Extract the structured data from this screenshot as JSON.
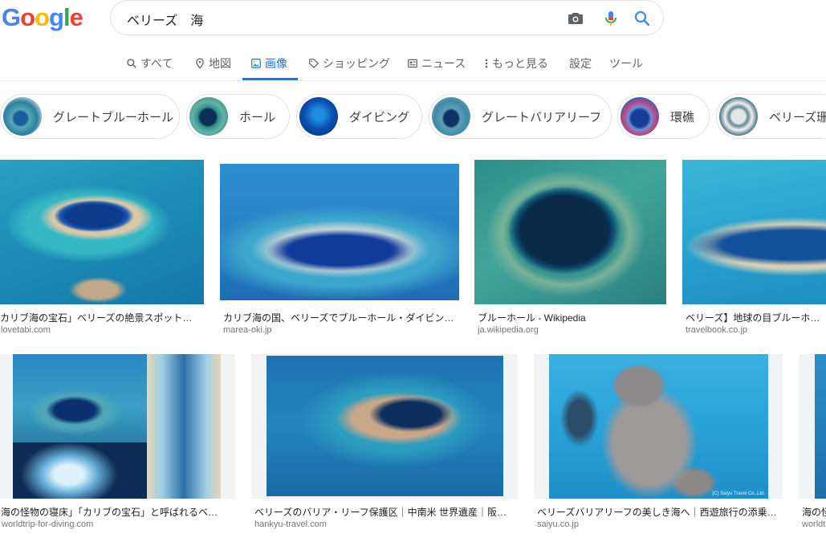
{
  "logo": {
    "letters": [
      "G",
      "o",
      "o",
      "g",
      "l",
      "e"
    ],
    "colors": [
      "#4285f4",
      "#ea4335",
      "#fbbc05",
      "#4285f4",
      "#34a853",
      "#ea4335"
    ]
  },
  "search": {
    "query": "ベリーズ　海",
    "icons": [
      "camera-icon",
      "mic-icon",
      "search-icon"
    ]
  },
  "tabs": [
    {
      "label": "すべて",
      "icon": "search-icon"
    },
    {
      "label": "地図",
      "icon": "map-pin-icon"
    },
    {
      "label": "画像",
      "icon": "image-icon"
    },
    {
      "label": "ショッピング",
      "icon": "tag-icon"
    },
    {
      "label": "ニュース",
      "icon": "news-icon"
    },
    {
      "label": "もっと見る",
      "icon": "more-vert-icon"
    },
    {
      "label": "設定"
    },
    {
      "label": "ツール"
    }
  ],
  "active_tab": "画像",
  "colors": {
    "accent": "#1a73e8",
    "tab_text": "#5f6368",
    "source_text": "#70757a"
  },
  "chips": [
    {
      "label": "グレートブルーホール"
    },
    {
      "label": "ホール"
    },
    {
      "label": "ダイビング"
    },
    {
      "label": "グレートバリアリーフ"
    },
    {
      "label": "環礁"
    },
    {
      "label": "ベリーズ珊瑚"
    }
  ],
  "results": [
    {
      "title": "カリブ海の宝石」ベリーズの絶景スポット…",
      "source": "lovetabi.com"
    },
    {
      "title": "カリブ海の国、ベリーズでブルーホール・ダイビン…",
      "source": "marea-oki.jp"
    },
    {
      "title": "ブルーホール - Wikipedia",
      "source": "ja.wikipedia.org"
    },
    {
      "title": "ベリーズ】地球の目ブルーホール",
      "source": "travelbook.co.jp"
    },
    {
      "title": "海の怪物の寝床」「カリブの宝石」と呼ばれるベ…",
      "source": "worldtrip-for-diving.com"
    },
    {
      "title": "ベリーズのバリア・リーフ保護区｜中南米 世界遺産｜阪…",
      "source": "hankyu-travel.com"
    },
    {
      "title": "ベリーズバリアリーフの美しき海へ｜西遊旅行の添乗…",
      "source": "saiyu.co.jp"
    },
    {
      "title": "海の怪",
      "source": "worldt"
    }
  ],
  "image_credit": "(C) Saiyu Travel Co.,Ltd."
}
